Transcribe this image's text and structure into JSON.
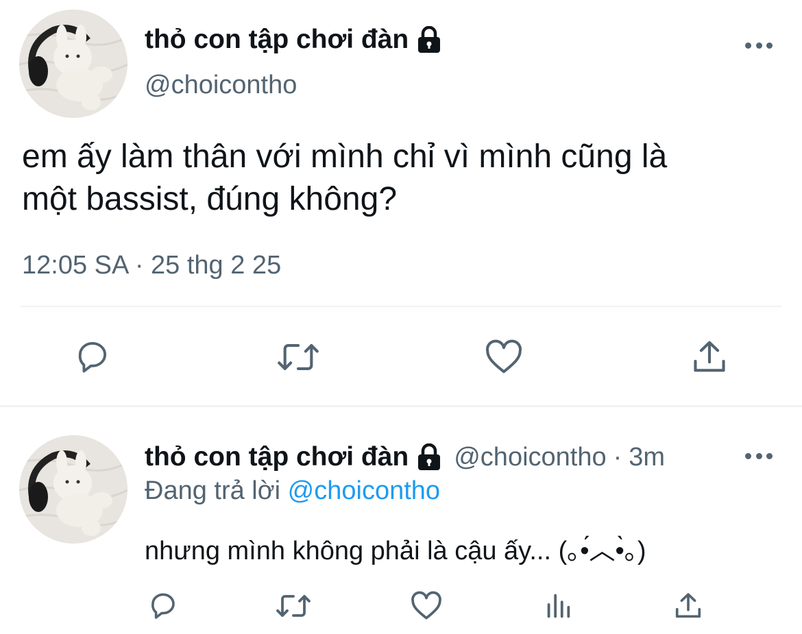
{
  "main_tweet": {
    "display_name": "thỏ con tập chơi đàn",
    "handle": "@choicontho",
    "text_line1": "em ấy làm thân với mình chỉ vì mình cũng là",
    "text_line2": "một bassist, đúng không?",
    "time": "12:05 SA",
    "separator": "·",
    "date": "25 thg 2 25"
  },
  "reply_tweet": {
    "display_name": "thỏ con tập chơi đàn",
    "handle": "@choicontho",
    "separator": "·",
    "age": "3m",
    "replying_label": "Đang trả lời",
    "replying_mention": "@choicontho",
    "text": "nhưng mình không phải là cậu ấy... (｡•́︿•̀｡)"
  },
  "icons": {
    "lock": "lock-icon",
    "more": "more-horizontal-icon",
    "reply": "reply-bubble-icon",
    "retweet": "retweet-icon",
    "like": "heart-icon",
    "views": "analytics-bars-icon",
    "share": "share-upload-icon"
  },
  "colors": {
    "text": "#0f1419",
    "secondary": "#536471",
    "accent": "#1d9bf0",
    "divider": "#eff3f4"
  }
}
